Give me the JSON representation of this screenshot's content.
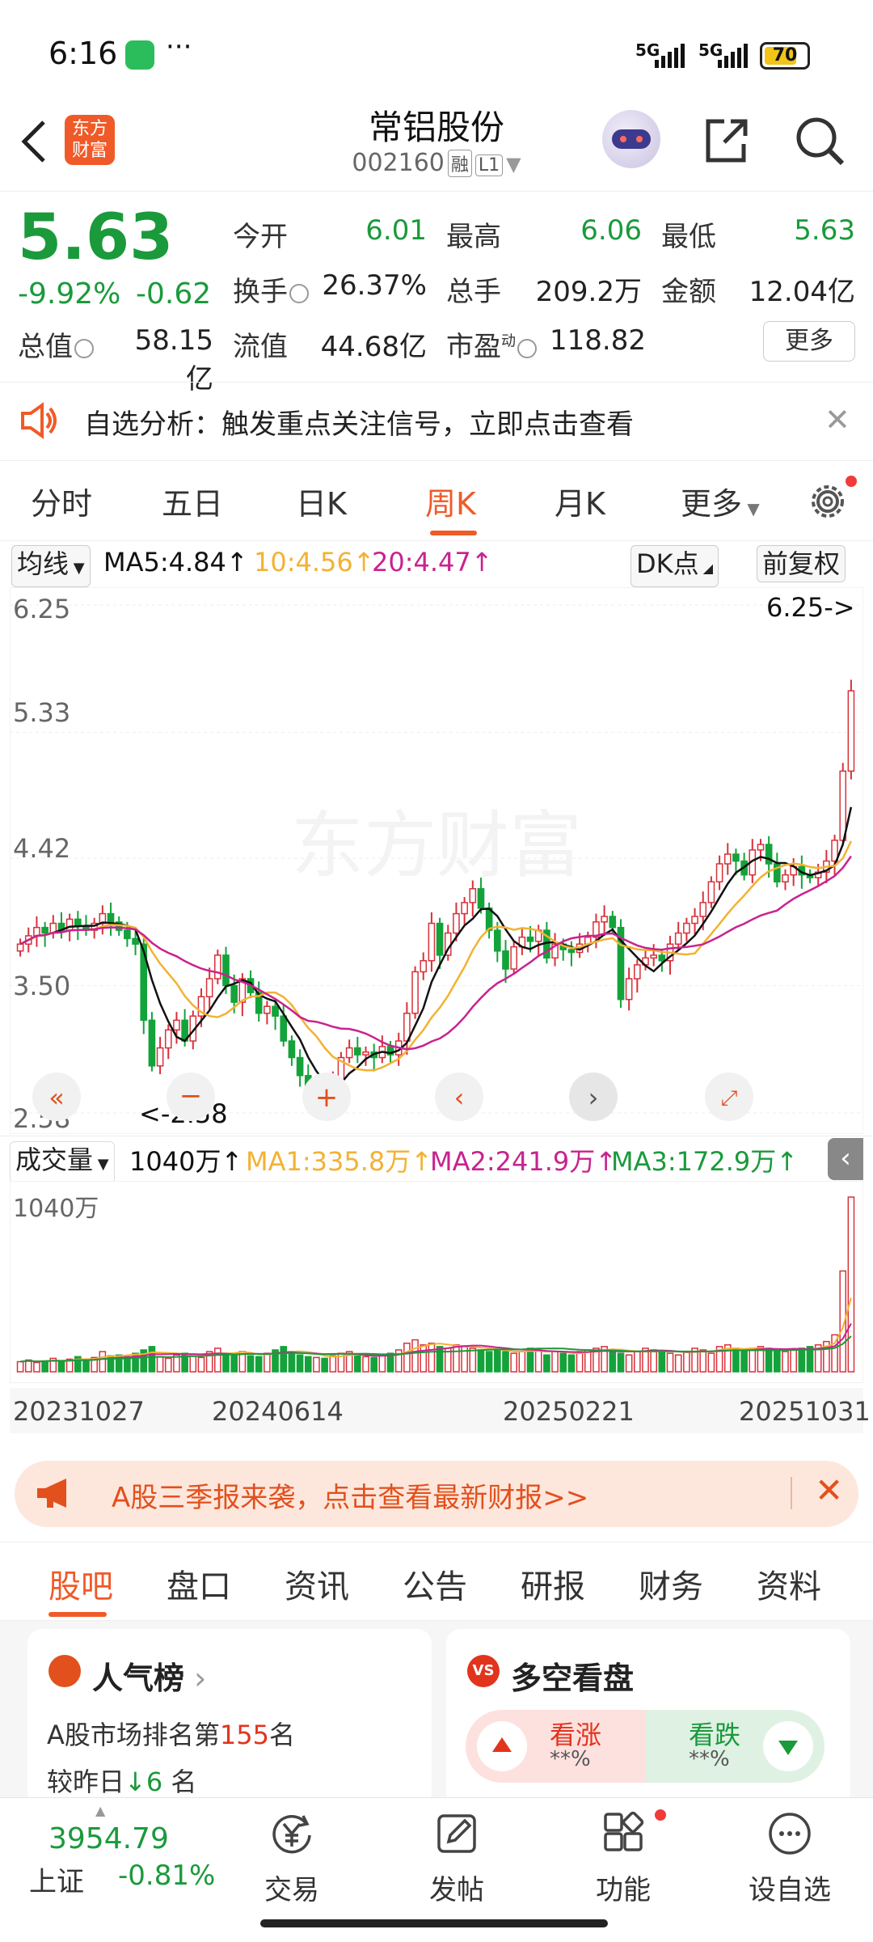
{
  "status_bar": {
    "time": "6:16",
    "signal1": "5G",
    "signal2": "5G",
    "battery": "70"
  },
  "header": {
    "app_logo_text": "东方财富",
    "stock_name": "常铝股份",
    "stock_code": "002160",
    "tag_margin": "融",
    "tag_level": "L1"
  },
  "quote": {
    "price": "5.63",
    "change_pct": "-9.92%",
    "change": "-0.62",
    "labels": {
      "open": "今开",
      "high": "最高",
      "low": "最低",
      "turnover": "换手",
      "volume": "总手",
      "amount": "金额",
      "mktcap": "总值",
      "float_cap": "流值",
      "pe": "市盈"
    },
    "values": {
      "open": "6.01",
      "high": "6.06",
      "low": "5.63",
      "turnover": "26.37%",
      "volume": "209.2万",
      "amount": "12.04亿",
      "mktcap": "58.15亿",
      "float_cap": "44.68亿",
      "pe": "118.82"
    },
    "pe_sup": "动",
    "more": "更多"
  },
  "notice": {
    "text": "自选分析：触发重点关注信号，立即点击查看"
  },
  "chart_tabs": [
    "分时",
    "五日",
    "日K",
    "周K",
    "月K",
    "更多"
  ],
  "ma_row": {
    "ma_type": "均线",
    "ma5": "MA5:4.84",
    "ma10": "10:4.56",
    "ma20": "20:4.47",
    "dk": "DK点",
    "adjust": "前复权",
    "colors": {
      "ma5": "#111111",
      "ma10": "#f2b233",
      "ma20": "#c8238f"
    }
  },
  "kchart": {
    "y_labels": [
      "6.25",
      "5.33",
      "4.42",
      "3.50",
      "2.58"
    ],
    "high_marker": "6.25->",
    "low_marker": "<-2.58",
    "watermark": "东方财富"
  },
  "vol_row": {
    "type": "成交量",
    "value": "1040万",
    "ma1": "MA1:335.8万",
    "ma2": "MA2:241.9万",
    "ma3": "MA3:172.9万"
  },
  "volchart": {
    "y_label": "1040万"
  },
  "dates": [
    "20231027",
    "20240614",
    "20250221",
    "20251031"
  ],
  "chart_data": {
    "type": "candlestick",
    "x_start": "20231027",
    "x_end": "20251031",
    "ylim": [
      2.58,
      6.25
    ],
    "close": [
      3.8,
      3.86,
      3.92,
      3.88,
      3.95,
      3.9,
      3.98,
      3.93,
      3.9,
      3.95,
      4.02,
      3.96,
      3.9,
      3.84,
      3.8,
      3.25,
      2.92,
      3.05,
      3.18,
      3.25,
      3.1,
      3.28,
      3.42,
      3.55,
      3.72,
      3.5,
      3.38,
      3.55,
      3.45,
      3.3,
      3.35,
      3.28,
      3.1,
      2.98,
      2.85,
      2.7,
      2.78,
      2.72,
      2.8,
      2.98,
      3.05,
      3.0,
      3.02,
      2.98,
      3.06,
      3.0,
      3.1,
      3.3,
      3.6,
      3.68,
      3.95,
      3.72,
      3.88,
      4.02,
      4.1,
      4.2,
      4.06,
      3.9,
      3.75,
      3.62,
      3.78,
      3.85,
      3.82,
      3.9,
      3.7,
      3.8,
      3.76,
      3.74,
      3.8,
      3.85,
      3.96,
      4.0,
      3.92,
      3.4,
      3.55,
      3.65,
      3.7,
      3.72,
      3.68,
      3.8,
      3.88,
      3.95,
      4.0,
      4.1,
      4.25,
      4.38,
      4.45,
      4.4,
      4.3,
      4.48,
      4.52,
      4.38,
      4.25,
      4.3,
      4.36,
      4.3,
      4.28,
      4.32,
      4.4,
      4.55,
      5.05,
      5.63
    ],
    "series": [
      {
        "name": "MA5",
        "value": "4.84"
      },
      {
        "name": "MA10",
        "value": "4.56"
      },
      {
        "name": "MA20",
        "value": "4.47"
      }
    ],
    "volume": [
      60,
      70,
      55,
      65,
      80,
      60,
      75,
      90,
      70,
      85,
      120,
      95,
      100,
      90,
      110,
      130,
      150,
      90,
      80,
      100,
      110,
      95,
      85,
      120,
      140,
      110,
      100,
      120,
      95,
      90,
      110,
      130,
      150,
      120,
      100,
      90,
      85,
      80,
      95,
      110,
      120,
      100,
      90,
      85,
      100,
      110,
      130,
      170,
      190,
      160,
      170,
      150,
      140,
      160,
      150,
      140,
      130,
      120,
      130,
      120,
      110,
      120,
      140,
      130,
      100,
      120,
      110,
      100,
      120,
      130,
      140,
      150,
      130,
      110,
      100,
      120,
      140,
      130,
      120,
      110,
      100,
      120,
      140,
      130,
      110,
      150,
      160,
      140,
      120,
      130,
      150,
      140,
      130,
      120,
      130,
      140,
      150,
      160,
      180,
      220,
      600,
      1040
    ],
    "volume_unit": "万",
    "volume_ma": [
      {
        "name": "MA1",
        "value": "335.8万"
      },
      {
        "name": "MA2",
        "value": "241.9万"
      },
      {
        "name": "MA3",
        "value": "172.9万"
      }
    ]
  },
  "banner": {
    "text": "A股三季报来袭，点击查看最新财报>>"
  },
  "sub_tabs": [
    "股吧",
    "盘口",
    "资讯",
    "公告",
    "研报",
    "财务",
    "资料"
  ],
  "cards": {
    "popularity": {
      "title": "人气榜",
      "rank_prefix": "A股市场排名第",
      "rank": "155",
      "rank_suffix": "名",
      "change_prefix": "较昨日",
      "change_val": "6",
      "change_suffix": "名"
    },
    "sentiment": {
      "title": "多空看盘",
      "up_label": "看涨",
      "up_pct": "**%",
      "down_label": "看跌",
      "down_pct": "**%"
    }
  },
  "bottom_nav": {
    "index_value": "3954.79",
    "index_name": "上证",
    "index_change": "-0.81%",
    "items": [
      "交易",
      "发帖",
      "功能",
      "设自选"
    ]
  }
}
